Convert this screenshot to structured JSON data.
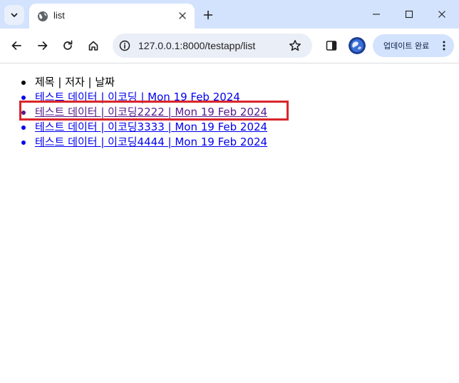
{
  "browser": {
    "tab_title": "list",
    "url": "127.0.0.1:8000/testapp/list",
    "update_button_label": "업데이트 완료",
    "icons": {
      "tab_search": "chevron-down-icon",
      "favicon": "globe-icon",
      "tab_close": "close-icon",
      "new_tab": "plus-icon",
      "back": "arrow-left-icon",
      "forward": "arrow-right-icon",
      "reload": "reload-icon",
      "home": "home-icon",
      "site_info": "info-icon",
      "bookmark": "star-icon",
      "side_panel": "side-panel-icon",
      "profile": "profile-avatar",
      "menu": "more-vertical-icon"
    }
  },
  "page": {
    "header_row": "제목 | 저자 | 날짜",
    "items": [
      {
        "text": "테스트 데이터 | 이코딩 | Mon 19 Feb 2024",
        "visited": false
      },
      {
        "text": "테스트 데이터 | 이코딩2222 | Mon 19 Feb 2024",
        "visited": true
      },
      {
        "text": "테스트 데이터 | 이코딩3333 | Mon 19 Feb 2024",
        "visited": false
      },
      {
        "text": "테스트 데이터 | 이코딩4444 | Mon 19 Feb 2024",
        "visited": false
      }
    ],
    "highlighted_item_index": 1,
    "colors": {
      "link": "#0000ee",
      "visited_link": "#551a8b",
      "highlight_border": "#d9252a",
      "tabstrip_bg": "#d3e3fd"
    }
  }
}
